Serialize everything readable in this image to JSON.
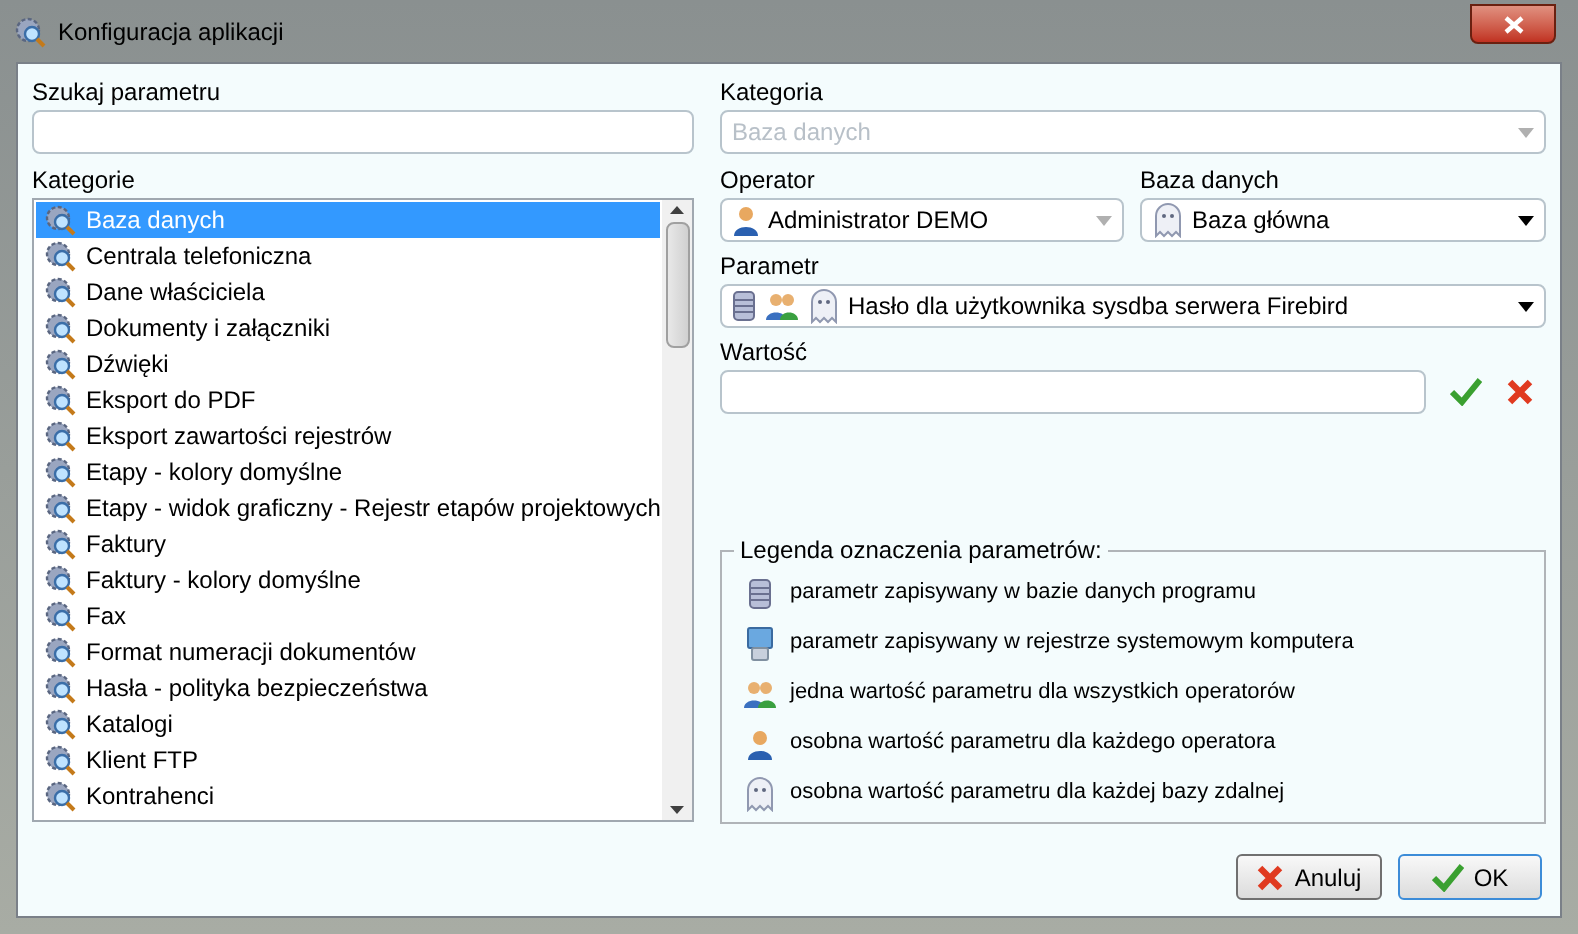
{
  "window": {
    "title": "Konfiguracja aplikacji"
  },
  "search": {
    "label": "Szukaj parametru"
  },
  "categories": {
    "label": "Kategorie",
    "items": [
      {
        "label": "Baza danych",
        "selected": true
      },
      {
        "label": "Centrala telefoniczna",
        "selected": false
      },
      {
        "label": "Dane właściciela",
        "selected": false
      },
      {
        "label": "Dokumenty i załączniki",
        "selected": false
      },
      {
        "label": "Dźwięki",
        "selected": false
      },
      {
        "label": "Eksport do PDF",
        "selected": false
      },
      {
        "label": "Eksport zawartości rejestrów",
        "selected": false
      },
      {
        "label": "Etapy - kolory domyślne",
        "selected": false
      },
      {
        "label": "Etapy - widok graficzny - Rejestr etapów projektowych",
        "selected": false
      },
      {
        "label": "Faktury",
        "selected": false
      },
      {
        "label": "Faktury - kolory domyślne",
        "selected": false
      },
      {
        "label": "Fax",
        "selected": false
      },
      {
        "label": "Format numeracji dokumentów",
        "selected": false
      },
      {
        "label": "Hasła - polityka bezpieczeństwa",
        "selected": false
      },
      {
        "label": "Katalogi",
        "selected": false
      },
      {
        "label": "Klient FTP",
        "selected": false
      },
      {
        "label": "Kontrahenci",
        "selected": false
      }
    ]
  },
  "category": {
    "label": "Kategoria",
    "value": "Baza danych",
    "disabled": true
  },
  "operator": {
    "label": "Operator",
    "value": "Administrator DEMO",
    "disabled": true
  },
  "database": {
    "label": "Baza danych",
    "value": "Baza główna",
    "disabled": false
  },
  "parameter": {
    "label": "Parametr",
    "value": "Hasło dla użytkownika sysdba serwera Firebird",
    "icons": [
      {
        "kind": "database"
      },
      {
        "kind": "users"
      },
      {
        "kind": "ghost"
      }
    ]
  },
  "value_field": {
    "label": "Wartość"
  },
  "legend": {
    "title": "Legenda oznaczenia parametrów:",
    "items": [
      {
        "kind": "database",
        "text": "parametr zapisywany w bazie danych programu"
      },
      {
        "kind": "computer",
        "text": "parametr zapisywany w rejestrze systemowym komputera"
      },
      {
        "kind": "users",
        "text": "jedna wartość parametru dla wszystkich operatorów"
      },
      {
        "kind": "user",
        "text": "osobna wartość parametru dla każdego operatora"
      },
      {
        "kind": "ghost",
        "text": "osobna wartość parametru dla każdej bazy zdalnej"
      }
    ]
  },
  "buttons": [
    {
      "kind": "cancel",
      "label": "Anuluj"
    },
    {
      "kind": "ok",
      "label": "OK"
    }
  ]
}
